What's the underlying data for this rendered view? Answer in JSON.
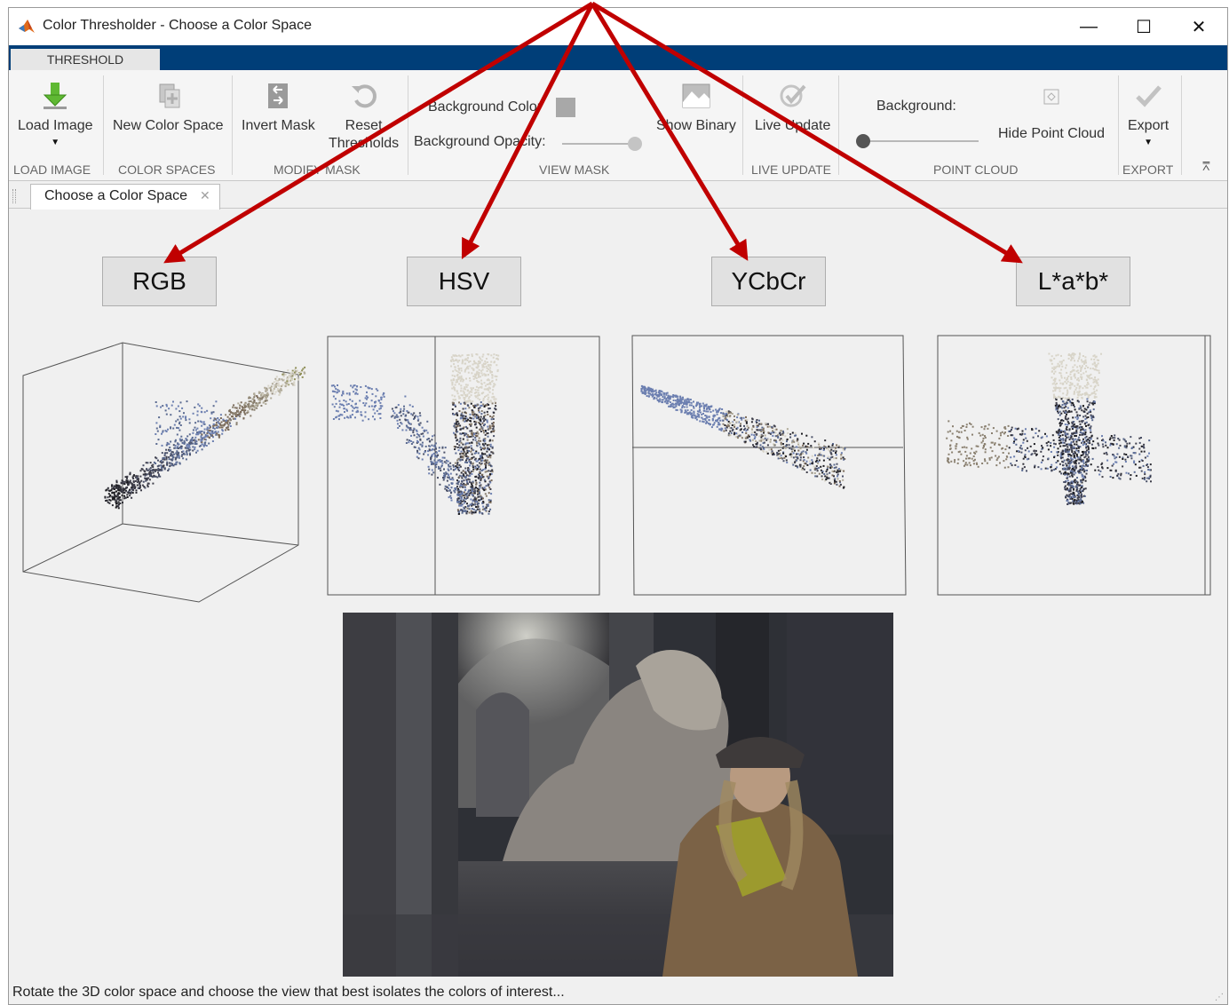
{
  "window": {
    "title": "Color Thresholder - Choose a Color Space",
    "controls": {
      "minimize": "—",
      "maximize": "☐",
      "close": "✕"
    }
  },
  "ribbon": {
    "tab": "THRESHOLD",
    "load_image": {
      "label": "Load Image",
      "group": "LOAD IMAGE"
    },
    "new_color_space": {
      "label": "New Color Space",
      "group": "COLOR SPACES"
    },
    "invert_mask": {
      "label": "Invert Mask"
    },
    "reset_thresholds": {
      "label_line1": "Reset",
      "label_line2": "Thresholds"
    },
    "modify_mask_group": "MODIFY MASK",
    "view_mask": {
      "background_color": "Background Color",
      "background_opacity": "Background Opacity:",
      "show_binary": "Show Binary",
      "group": "VIEW MASK",
      "opacity_level": 1.0
    },
    "live_update": {
      "label": "Live Update",
      "group": "LIVE UPDATE"
    },
    "point_cloud": {
      "background": "Background:",
      "hide_point_cloud": "Hide Point Cloud",
      "group": "POINT CLOUD",
      "background_level": 0.0
    },
    "export": {
      "label": "Export",
      "group": "EXPORT"
    }
  },
  "document_tab": {
    "label": "Choose a Color Space",
    "close": "✕"
  },
  "color_spaces": [
    {
      "label": "RGB"
    },
    {
      "label": "HSV"
    },
    {
      "label": "YCbCr"
    },
    {
      "label": "L*a*b*"
    }
  ],
  "status": {
    "text": "Rotate the 3D color space and choose the view that best isolates the colors of interest..."
  },
  "colors": {
    "ribbon_strip": "#003e78",
    "arrow": "#c00000",
    "button_face": "#e1e1e1",
    "matlab_orange": "#e16a1a"
  },
  "icons": [
    "matlab-logo-icon",
    "load-image-icon",
    "new-color-space-icon",
    "invert-mask-icon",
    "reset-icon",
    "show-binary-icon",
    "live-update-icon",
    "point-cloud-bg-icon",
    "export-icon"
  ]
}
